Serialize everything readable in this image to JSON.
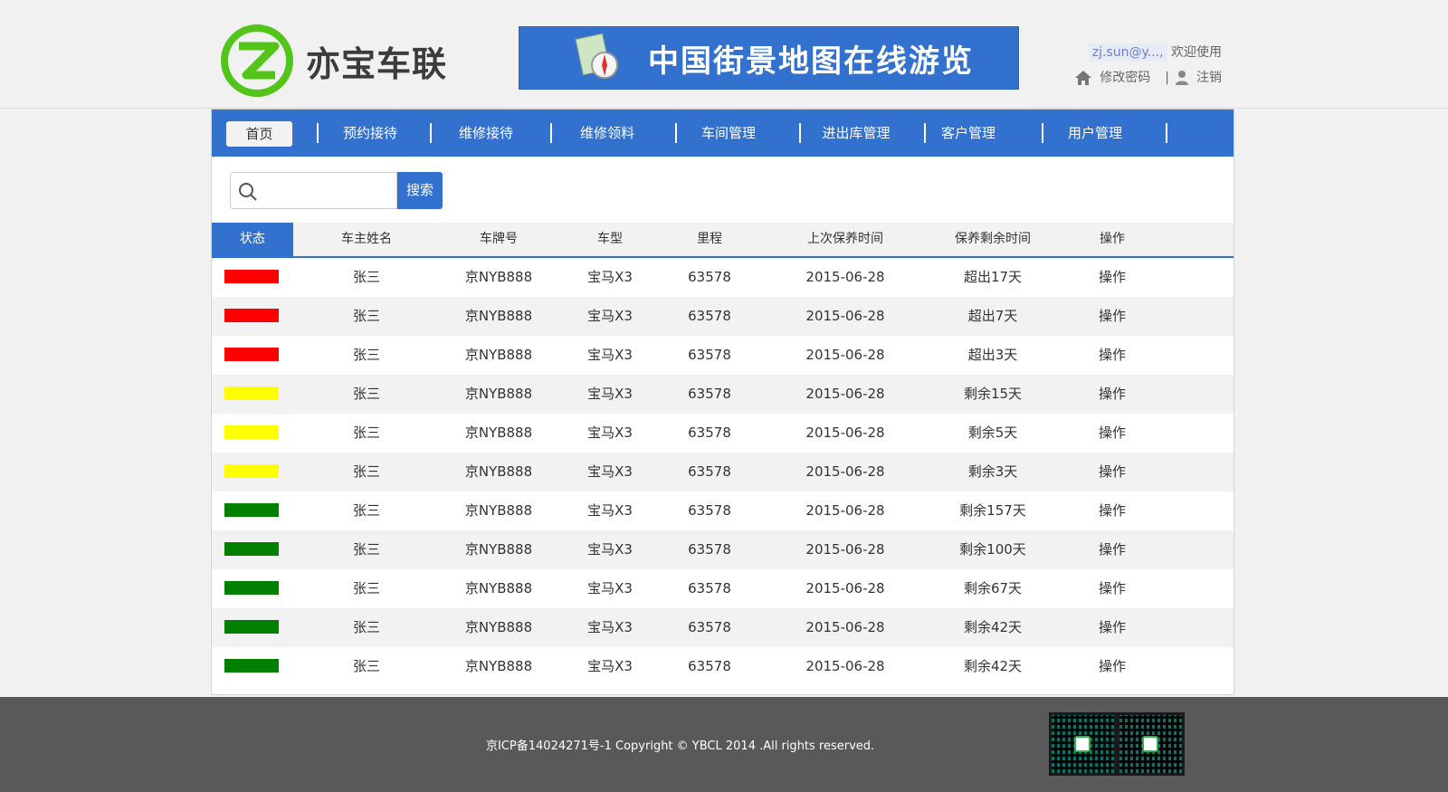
{
  "header": {
    "logo_text": "亦宝车联",
    "banner_text": "中国街景地图在线游览",
    "user_email": "zj.sun@y...,",
    "welcome": "欢迎使用",
    "change_password": "修改密码",
    "separator": "|",
    "logout": "注销"
  },
  "nav": {
    "items": [
      {
        "label": "首页",
        "active": true
      },
      {
        "label": "预约接待"
      },
      {
        "label": "维修接待"
      },
      {
        "label": "维修领料"
      },
      {
        "label": "车间管理"
      },
      {
        "label": "进出库管理"
      },
      {
        "label": "客户管理"
      },
      {
        "label": "用户管理"
      }
    ]
  },
  "search": {
    "placeholder": "",
    "button_label": "搜索"
  },
  "table": {
    "headers": [
      "状态",
      "车主姓名",
      "车牌号",
      "车型",
      "里程",
      "上次保养时间",
      "保养剩余时间",
      "操作"
    ],
    "rows": [
      {
        "status_color": "#ff0000",
        "owner": "张三",
        "plate": "京NYB888",
        "model": "宝马X3",
        "mileage": "63578",
        "last_service": "2015-06-28",
        "remaining": "超出17天",
        "action": "操作"
      },
      {
        "status_color": "#ff0000",
        "owner": "张三",
        "plate": "京NYB888",
        "model": "宝马X3",
        "mileage": "63578",
        "last_service": "2015-06-28",
        "remaining": "超出7天",
        "action": "操作"
      },
      {
        "status_color": "#ff0000",
        "owner": "张三",
        "plate": "京NYB888",
        "model": "宝马X3",
        "mileage": "63578",
        "last_service": "2015-06-28",
        "remaining": "超出3天",
        "action": "操作"
      },
      {
        "status_color": "#ffff00",
        "owner": "张三",
        "plate": "京NYB888",
        "model": "宝马X3",
        "mileage": "63578",
        "last_service": "2015-06-28",
        "remaining": "剩余15天",
        "action": "操作"
      },
      {
        "status_color": "#ffff00",
        "owner": "张三",
        "plate": "京NYB888",
        "model": "宝马X3",
        "mileage": "63578",
        "last_service": "2015-06-28",
        "remaining": "剩余5天",
        "action": "操作"
      },
      {
        "status_color": "#ffff00",
        "owner": "张三",
        "plate": "京NYB888",
        "model": "宝马X3",
        "mileage": "63578",
        "last_service": "2015-06-28",
        "remaining": "剩余3天",
        "action": "操作"
      },
      {
        "status_color": "#008000",
        "owner": "张三",
        "plate": "京NYB888",
        "model": "宝马X3",
        "mileage": "63578",
        "last_service": "2015-06-28",
        "remaining": "剩余157天",
        "action": "操作"
      },
      {
        "status_color": "#008000",
        "owner": "张三",
        "plate": "京NYB888",
        "model": "宝马X3",
        "mileage": "63578",
        "last_service": "2015-06-28",
        "remaining": "剩余100天",
        "action": "操作"
      },
      {
        "status_color": "#008000",
        "owner": "张三",
        "plate": "京NYB888",
        "model": "宝马X3",
        "mileage": "63578",
        "last_service": "2015-06-28",
        "remaining": "剩余67天",
        "action": "操作"
      },
      {
        "status_color": "#008000",
        "owner": "张三",
        "plate": "京NYB888",
        "model": "宝马X3",
        "mileage": "63578",
        "last_service": "2015-06-28",
        "remaining": "剩余42天",
        "action": "操作"
      },
      {
        "status_color": "#008000",
        "owner": "张三",
        "plate": "京NYB888",
        "model": "宝马X3",
        "mileage": "63578",
        "last_service": "2015-06-28",
        "remaining": "剩余42天",
        "action": "操作"
      }
    ]
  },
  "footer": {
    "copyright": "京ICP备14024271号-1 Copyright © YBCL 2014 .All rights reserved."
  },
  "colors": {
    "brand_blue": "#3371cf",
    "footer_bg": "#595959"
  }
}
